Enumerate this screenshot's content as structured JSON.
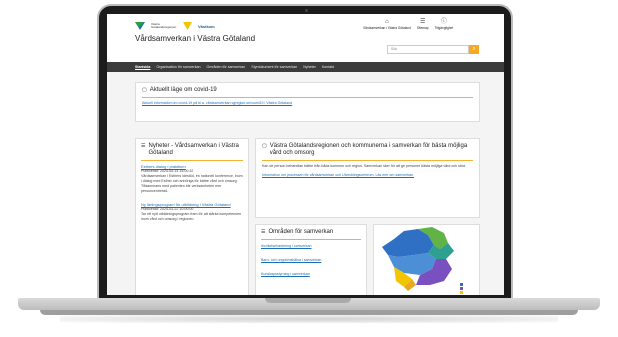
{
  "header": {
    "logo_text": "Västra Götalandsregionen",
    "logo2_text": "Västkom",
    "site_title": "Vårdsamverkan i Västra Götaland",
    "top_links": [
      {
        "label": "Vårdsamverkan i Västra Götaland",
        "icon": "home-icon"
      },
      {
        "label": "Sitemap",
        "icon": "sitemap-icon"
      },
      {
        "label": "Tillgänglighet",
        "icon": "accessibility-icon"
      }
    ],
    "search_placeholder": "Sök"
  },
  "nav": {
    "items": [
      "Startsida",
      "Organisation för samverkan",
      "Områden för samverkan",
      "Styrdokument för samverkan",
      "Nyheter",
      "Kontakt"
    ]
  },
  "covid": {
    "title": "Aktuellt läge om covid-19",
    "text": "Aktuell information om covid-19 på bl.a. vårdsamverkan.vgregion.se/covid19 i Västra Götaland"
  },
  "news": {
    "title": "Nyheter - Vårdsamverkan i Västra Götaland",
    "item1_title": "Esthers dialog i praktiken",
    "item1_date": "Publicerad: 2024-05-14 15:00:32",
    "item1_text": "Vårdsamverkan i Esthers idéstöd, en nationell konference, inom i dialog med Esther och anhöriga för bättre vård och omsorg. Tillsammans med patienten blir verksamheten mer personcentrerad.",
    "item2_title": "Ny lärlingsprogram för utbildning i Västra Götaland",
    "item2_date": "Publicerad: 2024-03-22 10:00:00",
    "item2_text": "Tar ett nytt utbildningsprogram fram för att stärka kompetensen inom vård och omsorg i regionen."
  },
  "vg": {
    "title": "Västra Götalandsregionen och kommunerna i samverkan för bästa möjliga vård och omsorg",
    "text": "Kan de person behandlas bättre från båda kommun och region. Samverkan sker för att ge personer bästa möjliga vård och stöd.",
    "link": "Information om processen för vårdsamverkan och Utvecklingscentrum. Läs mer om samverkan."
  },
  "areas": {
    "title": "Områden för samverkan",
    "links": [
      "Avvikelsehantering i samverkan",
      "Barn- och ungdomshälsa i samverkan",
      "Kunskapsstyrning i samverkan"
    ]
  },
  "colors": {
    "accent": "#f2b233",
    "nav_bg": "#3b3b3b",
    "link": "#1e6fb5",
    "search_btn": "#f7a823"
  }
}
